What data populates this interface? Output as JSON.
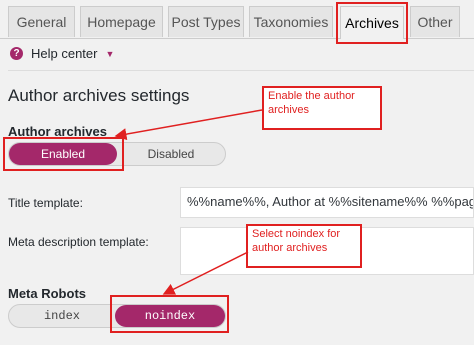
{
  "tabs": [
    {
      "label": "General"
    },
    {
      "label": "Homepage"
    },
    {
      "label": "Post Types"
    },
    {
      "label": "Taxonomies"
    },
    {
      "label": "Archives"
    },
    {
      "label": "Other"
    }
  ],
  "help": {
    "label": "Help center"
  },
  "section": {
    "title": "Author archives settings"
  },
  "author_archives": {
    "label": "Author archives",
    "enabled_label": "Enabled",
    "disabled_label": "Disabled",
    "selected": "Enabled"
  },
  "title_template": {
    "label": "Title template:",
    "value": "%%name%%, Author at %%sitename%% %%page%%"
  },
  "meta_description": {
    "label": "Meta description template:",
    "value": ""
  },
  "meta_robots": {
    "label": "Meta Robots",
    "index_label": "index",
    "noindex_label": "noindex",
    "selected": "noindex"
  },
  "annotations": {
    "enable_author": "Enable the author archives",
    "select_noindex": "Select noindex for author archives"
  },
  "colors": {
    "accent": "#a4286a",
    "annotation": "#e02020"
  }
}
